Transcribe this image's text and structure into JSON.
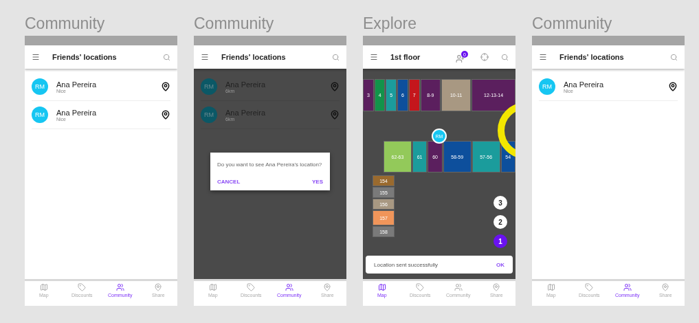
{
  "screens": [
    {
      "kind": "list",
      "heading": "Community",
      "app_bar": {
        "title": "Friends' locations"
      },
      "friends": [
        {
          "initials": "RM",
          "name": "Ana Pereira",
          "detail": "Nice"
        },
        {
          "initials": "RM",
          "name": "Ana Pereira",
          "detail": "Nice"
        }
      ],
      "nav": [
        {
          "label": "Map",
          "selected": false
        },
        {
          "label": "Discounts",
          "selected": false
        },
        {
          "label": "Community",
          "selected": true
        },
        {
          "label": "Share",
          "selected": false
        }
      ]
    },
    {
      "kind": "dialog",
      "heading": "Community",
      "app_bar": {
        "title": "Friends' locations"
      },
      "friends": [
        {
          "initials": "RM",
          "name": "Ana Pereira",
          "detail": "6km"
        },
        {
          "initials": "RM",
          "name": "Ana Pereira",
          "detail": "6km"
        }
      ],
      "dialog": {
        "message": "Do you want to see Ana Pereira's location?",
        "buttons": [
          "CANCEL",
          "YES"
        ]
      },
      "nav": [
        {
          "label": "Map",
          "selected": false
        },
        {
          "label": "Discounts",
          "selected": false
        },
        {
          "label": "Community",
          "selected": true
        },
        {
          "label": "Share",
          "selected": false
        }
      ]
    },
    {
      "kind": "map",
      "heading": "Explore",
      "app_bar": {
        "title": "1st floor",
        "badge": "0"
      },
      "map": {
        "top_row": [
          {
            "label": "3",
            "color": "#5b1f5e"
          },
          {
            "label": "4",
            "color": "#12934a"
          },
          {
            "label": "5",
            "color": "#1b9c9c"
          },
          {
            "label": "6",
            "color": "#0d4f9c"
          },
          {
            "label": "7",
            "color": "#c4161c"
          },
          {
            "label": "8-9",
            "color": "#5b1f5e"
          },
          {
            "label": "10-11",
            "color": "#a89882"
          },
          {
            "label": "12-13-14",
            "color": "#5b1f5e"
          }
        ],
        "middle_row": [
          {
            "label": "62-63",
            "color": "#93c95a"
          },
          {
            "label": "61",
            "color": "#1b9c9c"
          },
          {
            "label": "60",
            "color": "#5b1f5e"
          },
          {
            "label": "58-59",
            "color": "#0d4f9c"
          },
          {
            "label": "57-56",
            "color": "#1b9c9c"
          },
          {
            "label": "54",
            "color": "#0d4f9c"
          }
        ],
        "left_column": [
          {
            "label": "154",
            "color": "#9a6a2e"
          },
          {
            "label": "155",
            "color": "#7a7a7a"
          },
          {
            "label": "156",
            "color": "#a89882"
          },
          {
            "label": "157",
            "color": "#f0955a"
          },
          {
            "label": "158",
            "color": "#7a7a7a"
          }
        ],
        "markers": [
          {
            "label": "3",
            "selected": false
          },
          {
            "label": "2",
            "selected": false
          },
          {
            "label": "1",
            "selected": true
          }
        ],
        "pin": "RM",
        "snackbar": {
          "message": "Location sent successfully",
          "action": "OK"
        }
      },
      "nav": [
        {
          "label": "Map",
          "selected": true
        },
        {
          "label": "Discounts",
          "selected": false
        },
        {
          "label": "Community",
          "selected": false
        },
        {
          "label": "Share",
          "selected": false
        }
      ]
    },
    {
      "kind": "list",
      "heading": "Community",
      "app_bar": {
        "title": "Friends' locations"
      },
      "friends": [
        {
          "initials": "RM",
          "name": "Ana Pereira",
          "detail": "Nice"
        }
      ],
      "nav": [
        {
          "label": "Map",
          "selected": false
        },
        {
          "label": "Discounts",
          "selected": false
        },
        {
          "label": "Community",
          "selected": true
        },
        {
          "label": "Share",
          "selected": false
        }
      ]
    }
  ]
}
